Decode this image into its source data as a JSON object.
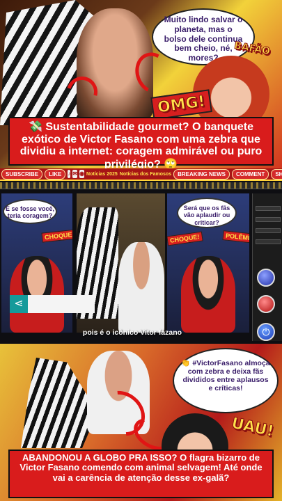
{
  "top": {
    "speech": "Muito lindo salvar o planeta, mas o bolso dele continua bem cheio, né, mores?",
    "burst_bafao": "BAFÃO",
    "burst_omg": "OMG!",
    "caption_emoji_start": "💸",
    "caption": "Sustentabilidade gourmet? O banquete exótico de Victor Fasano com uma zebra que dividiu a internet: coragem admirável ou puro privilégio?",
    "caption_emoji_end": "🙄"
  },
  "toolbar": {
    "subscribe": "SUBSCRIBE",
    "like": "LIKE",
    "news1": "Notícias 2025",
    "news2": "Notícias dos Famosos",
    "breaking": "BREAKING NEWS",
    "comment": "COMMENT",
    "share": "SHARE"
  },
  "middle": {
    "left_bubble": "E se fosse você, teria coragem?",
    "left_pow": "CHOQUE!",
    "right_bubble": "Será que os fãs vão aplaudir ou criticar?",
    "right_pow1": "CHOQUE!",
    "right_pow2": "POLÊMICA",
    "subtitle": "pois é o icônico Vitor fazano",
    "share_icon": "share-icon"
  },
  "bottom": {
    "speech": "#VictorFasano almoça com zebra e deixa fãs divididos entre aplausos e críticas!",
    "speech_emoji": "👏",
    "burst_uau": "UAU!",
    "caption": "ABANDONOU A GLOBO PRA ISSO? O flagra bizarro de Victor Fasano comendo com animal selvagem! Até onde vai a carência de atenção desse ex-galã?"
  },
  "colors": {
    "accent_red": "#d91c1c",
    "accent_yellow": "#ffe24a",
    "speech_text": "#3a1e6a"
  }
}
